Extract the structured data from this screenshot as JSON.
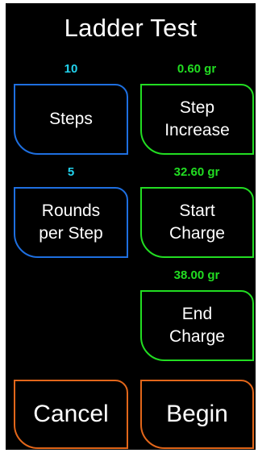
{
  "title": "Ladder Test",
  "colors": {
    "background": "#000000",
    "text": "#ffffff",
    "blue_value": "#22d3ee",
    "blue_border": "#1e6fe0",
    "green": "#22dd22",
    "orange_border": "#e2661a"
  },
  "steps": {
    "value": "10",
    "label": "Steps"
  },
  "step_increase": {
    "value": "0.60 gr",
    "label": "Step\nIncrease"
  },
  "rounds_per_step": {
    "value": "5",
    "label": "Rounds\nper Step"
  },
  "start_charge": {
    "value": "32.60 gr",
    "label": "Start\nCharge"
  },
  "end_charge": {
    "value": "38.00 gr",
    "label": "End\nCharge"
  },
  "cancel": {
    "label": "Cancel"
  },
  "begin": {
    "label": "Begin"
  }
}
